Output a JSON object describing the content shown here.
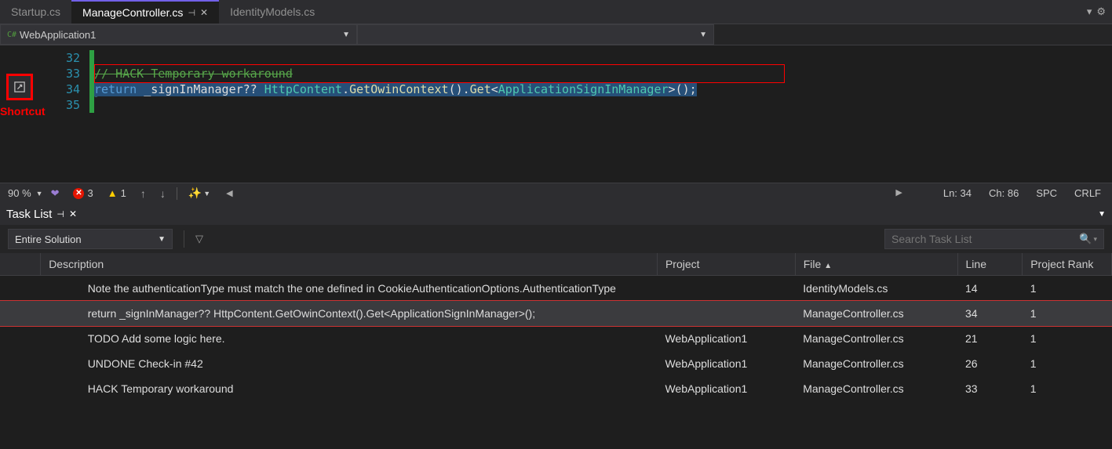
{
  "tabs": {
    "items": [
      {
        "label": "Startup.cs"
      },
      {
        "label": "ManageController.cs"
      },
      {
        "label": "IdentityModels.cs"
      }
    ]
  },
  "nav": {
    "scope": "WebApplication1"
  },
  "editor": {
    "lines": [
      "32",
      "33",
      "34",
      "35"
    ],
    "comment": "// HACK Temporary workaround",
    "code": {
      "return": "return",
      "sp1": " ",
      "ident": "_signInManager",
      "q": "?? ",
      "type1": "HttpContent",
      "dot1": ".",
      "m1": "GetOwinContext",
      "p1": "().",
      "m2": "Get",
      "lt": "<",
      "type2": "ApplicationSignInManager",
      "gt": ">",
      "p2": "();"
    },
    "shortcut_label": "Shortcut"
  },
  "status": {
    "zoom": "90 %",
    "errors": "3",
    "warnings": "1",
    "ln": "Ln: 34",
    "ch": "Ch: 86",
    "spc": "SPC",
    "crlf": "CRLF"
  },
  "task_panel": {
    "title": "Task List",
    "scope": "Entire Solution",
    "search_placeholder": "Search Task List",
    "columns": {
      "desc": "Description",
      "project": "Project",
      "file": "File",
      "line": "Line",
      "rank": "Project Rank"
    },
    "rows": [
      {
        "desc": "Note the authenticationType must match the one defined in CookieAuthenticationOptions.AuthenticationType",
        "project": "",
        "file": "IdentityModels.cs",
        "line": "14",
        "rank": "1"
      },
      {
        "desc": "return _signInManager?? HttpContent.GetOwinContext().Get<ApplicationSignInManager>();",
        "project": "",
        "file": "ManageController.cs",
        "line": "34",
        "rank": "1"
      },
      {
        "desc": "TODO Add some logic here.",
        "project": "WebApplication1",
        "file": "ManageController.cs",
        "line": "21",
        "rank": "1"
      },
      {
        "desc": "UNDONE Check-in #42",
        "project": "WebApplication1",
        "file": "ManageController.cs",
        "line": "26",
        "rank": "1"
      },
      {
        "desc": "HACK Temporary workaround",
        "project": "WebApplication1",
        "file": "ManageController.cs",
        "line": "33",
        "rank": "1"
      }
    ]
  }
}
